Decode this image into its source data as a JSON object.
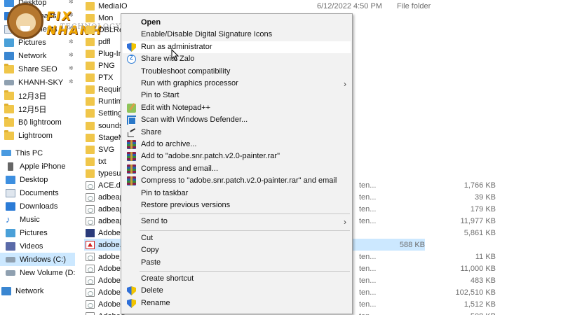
{
  "nav": {
    "items": [
      {
        "label": "Desktop",
        "icon": "desktop-icon",
        "pinned": true
      },
      {
        "label": "Downloads",
        "icon": "download-icon",
        "pinned": true
      },
      {
        "label": "Documents",
        "icon": "documents-icon",
        "pinned": true
      },
      {
        "label": "Pictures",
        "icon": "pictures-icon",
        "pinned": true
      },
      {
        "label": "Network",
        "icon": "network-icon",
        "pinned": true
      },
      {
        "label": "Share SEO",
        "icon": "folder-icon",
        "pinned": true
      },
      {
        "label": "KHANH-SKY",
        "icon": "network-drive-icon",
        "pinned": true
      },
      {
        "label": "12月3日",
        "icon": "folder-icon"
      },
      {
        "label": "12月5日",
        "icon": "folder-icon"
      },
      {
        "label": "Bộ lightroom",
        "icon": "folder-icon"
      },
      {
        "label": "Lightroom",
        "icon": "folder-icon"
      },
      {
        "label": "This PC",
        "icon": "this-pc-icon"
      },
      {
        "label": "Apple iPhone",
        "icon": "phone-icon"
      },
      {
        "label": "Desktop",
        "icon": "desktop-icon"
      },
      {
        "label": "Documents",
        "icon": "documents-icon"
      },
      {
        "label": "Downloads",
        "icon": "download-icon"
      },
      {
        "label": "Music",
        "icon": "music-icon"
      },
      {
        "label": "Pictures",
        "icon": "pictures-icon"
      },
      {
        "label": "Videos",
        "icon": "videos-icon"
      },
      {
        "label": "Windows (C:)",
        "icon": "drive-icon",
        "selected": true
      },
      {
        "label": "New Volume (D:)",
        "icon": "drive-icon"
      },
      {
        "label": "Network",
        "icon": "network-icon"
      }
    ]
  },
  "logo": {
    "brand": "FIX NHANH",
    "sub": "TECHNOLOGY"
  },
  "files": {
    "rows": [
      {
        "name": "MediaIO",
        "kind": "folder",
        "date": "6/12/2022 4:50 PM",
        "type": "File folder"
      },
      {
        "name": "Mon",
        "kind": "folder"
      },
      {
        "name": "OBLRes",
        "kind": "folder"
      },
      {
        "name": "pdfl",
        "kind": "folder"
      },
      {
        "name": "Plug-Ins",
        "kind": "folder"
      },
      {
        "name": "PNG",
        "kind": "folder"
      },
      {
        "name": "PTX",
        "kind": "folder"
      },
      {
        "name": "Require",
        "kind": "folder"
      },
      {
        "name": "Runtime",
        "kind": "folder"
      },
      {
        "name": "Settings",
        "kind": "folder"
      },
      {
        "name": "sounds",
        "kind": "folder"
      },
      {
        "name": "StageM",
        "kind": "folder"
      },
      {
        "name": "SVG",
        "kind": "folder"
      },
      {
        "name": "txt",
        "kind": "folder"
      },
      {
        "name": "typesup",
        "kind": "folder"
      },
      {
        "name": "ACE.dll",
        "kind": "doc",
        "type": "ten...",
        "size": "1,766 KB"
      },
      {
        "name": "adbeape",
        "kind": "doc",
        "type": "ten...",
        "size": "39 KB"
      },
      {
        "name": "adbeape",
        "kind": "doc",
        "type": "ten...",
        "size": "179 KB"
      },
      {
        "name": "adbeape",
        "kind": "doc",
        "type": "ten...",
        "size": "11,977 KB"
      },
      {
        "name": "Adobe M",
        "kind": "app",
        "size": "5,861 KB"
      },
      {
        "name": "adobe.s",
        "kind": "adobe",
        "size": "588 KB",
        "selected": true
      },
      {
        "name": "adobe_c",
        "kind": "doc",
        "type": "ten...",
        "size": "11 KB"
      },
      {
        "name": "AdobeP",
        "kind": "doc",
        "type": "ten...",
        "size": "11,000 KB"
      },
      {
        "name": "AdobeP",
        "kind": "doc",
        "type": "ten...",
        "size": "483 KB"
      },
      {
        "name": "AdobeP",
        "kind": "doc",
        "type": "ten...",
        "size": "102,510 KB"
      },
      {
        "name": "AdobeX",
        "kind": "doc",
        "type": "ten...",
        "size": "1,512 KB"
      },
      {
        "name": "AdobeX",
        "kind": "doc",
        "type": "ten...",
        "size": "508 KB"
      }
    ]
  },
  "context_menu": {
    "items": [
      {
        "label": "Open",
        "bold": true,
        "type": "item"
      },
      {
        "label": "Enable/Disable Digital Signature Icons",
        "type": "item"
      },
      {
        "label": "Run as administrator",
        "icon": "shield-icon",
        "type": "item",
        "hover": true
      },
      {
        "label": "Share with Zalo",
        "icon": "zalo-icon",
        "type": "item"
      },
      {
        "label": "Troubleshoot compatibility",
        "type": "item"
      },
      {
        "label": "Run with graphics processor",
        "type": "item",
        "submenu": true
      },
      {
        "label": "Pin to Start",
        "type": "item"
      },
      {
        "label": "Edit with Notepad++",
        "icon": "notepad-icon",
        "type": "item"
      },
      {
        "label": "Scan with Windows Defender...",
        "icon": "defender-icon",
        "type": "item"
      },
      {
        "label": "Share",
        "icon": "share-icon",
        "type": "item"
      },
      {
        "label": "Add to archive...",
        "icon": "winrar-icon",
        "type": "item"
      },
      {
        "label": "Add to \"adobe.snr.patch.v2.0-painter.rar\"",
        "icon": "winrar-icon",
        "type": "item"
      },
      {
        "label": "Compress and email...",
        "icon": "winrar-icon",
        "type": "item"
      },
      {
        "label": "Compress to \"adobe.snr.patch.v2.0-painter.rar\" and email",
        "icon": "winrar-icon",
        "type": "item"
      },
      {
        "label": "Pin to taskbar",
        "type": "item"
      },
      {
        "label": "Restore previous versions",
        "type": "item"
      },
      {
        "type": "separator"
      },
      {
        "label": "Send to",
        "type": "item",
        "submenu": true
      },
      {
        "type": "separator"
      },
      {
        "label": "Cut",
        "type": "item"
      },
      {
        "label": "Copy",
        "type": "item"
      },
      {
        "label": "Paste",
        "type": "item"
      },
      {
        "type": "separator"
      },
      {
        "label": "Create shortcut",
        "type": "item"
      },
      {
        "label": "Delete",
        "icon": "shield-icon",
        "type": "item"
      },
      {
        "label": "Rename",
        "icon": "shield-icon",
        "type": "item"
      }
    ]
  },
  "colors": {
    "selection": "#cce8ff",
    "menu_bg": "#f2f2f2",
    "folder": "#f0c64a",
    "brand": "#f2a900"
  }
}
